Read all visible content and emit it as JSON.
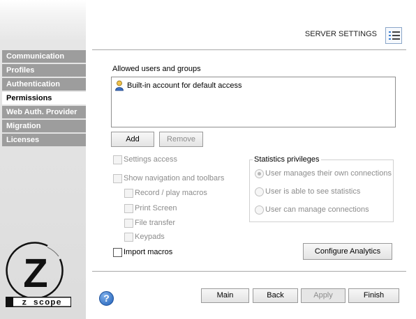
{
  "sidebar": {
    "items": [
      {
        "label": "Communication"
      },
      {
        "label": "Profiles"
      },
      {
        "label": "Authentication"
      },
      {
        "label": "Permissions",
        "active": true
      },
      {
        "label": "Web Auth. Provider"
      },
      {
        "label": "Migration"
      },
      {
        "label": "Licenses"
      }
    ]
  },
  "logo": {
    "letter": "Z",
    "brand": "z scope"
  },
  "header": {
    "title": "SERVER SETTINGS",
    "icon": "list-settings-icon"
  },
  "users": {
    "label": "Allowed users and groups",
    "items": [
      {
        "name": "Built-in account for default access",
        "icon": "user-icon"
      }
    ],
    "add_label": "Add",
    "remove_label": "Remove"
  },
  "options": {
    "settings_access": "Settings access",
    "show_navigation": "Show navigation and toolbars",
    "record_macros": "Record / play macros",
    "print_screen": "Print Screen",
    "file_transfer": "File transfer",
    "keypads": "Keypads",
    "import_macros": "Import macros"
  },
  "stats": {
    "title": "Statistics privileges",
    "own": "User manages their own connections",
    "see": "User is able to see statistics",
    "manage": "User can manage connections",
    "selected": "own"
  },
  "configure_label": "Configure Analytics",
  "footer": {
    "main": "Main",
    "back": "Back",
    "apply": "Apply",
    "finish": "Finish"
  },
  "colors": {
    "nav": "#9d9d9d",
    "accent": "#1f5fb8",
    "disabled_text": "#8c8c8c"
  }
}
